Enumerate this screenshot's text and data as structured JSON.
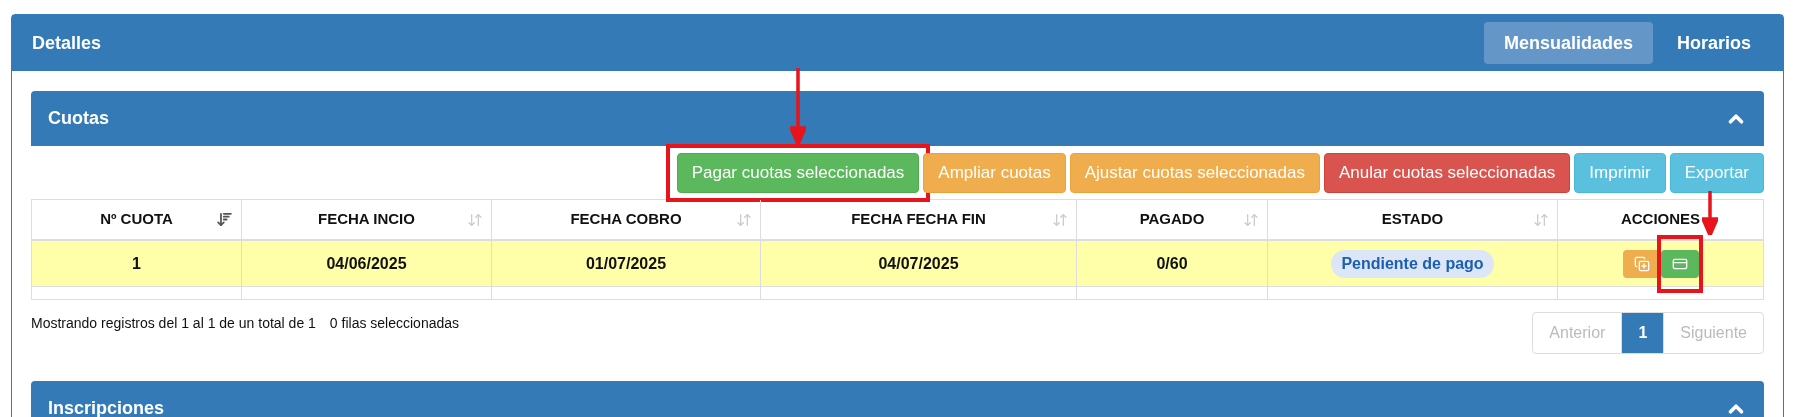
{
  "panel": {
    "title": "Detalles",
    "tabs": [
      {
        "label": "Mensualidades",
        "selected": true
      },
      {
        "label": "Horarios",
        "selected": false
      }
    ]
  },
  "cuotas": {
    "title": "Cuotas",
    "expanded": true,
    "buttons": [
      {
        "label": "Pagar cuotas seleccionadas",
        "kind": "success",
        "highlighted": true
      },
      {
        "label": "Ampliar cuotas",
        "kind": "warning",
        "highlighted": false
      },
      {
        "label": "Ajustar cuotas seleccionadas",
        "kind": "warning",
        "highlighted": false
      },
      {
        "label": "Anular cuotas seleccionadas",
        "kind": "danger",
        "highlighted": false
      },
      {
        "label": "Imprimir",
        "kind": "info",
        "highlighted": false
      },
      {
        "label": "Exportar",
        "kind": "info",
        "highlighted": false
      }
    ],
    "table": {
      "columns": [
        {
          "label": "Nº CUOTA",
          "sortable": true,
          "sorted": true
        },
        {
          "label": "FECHA INCIO",
          "sortable": true,
          "sorted": false
        },
        {
          "label": "FECHA COBRO",
          "sortable": true,
          "sorted": false
        },
        {
          "label": "FECHA FECHA FIN",
          "sortable": true,
          "sorted": false
        },
        {
          "label": "PAGADO",
          "sortable": true,
          "sorted": false
        },
        {
          "label": "ESTADO",
          "sortable": true,
          "sorted": false
        },
        {
          "label": "ACCIONES"
        }
      ],
      "rows": [
        {
          "cells": [
            "1",
            "04/06/2025",
            "01/07/2025",
            "04/07/2025",
            "0/60"
          ],
          "status": "Pendiente de pago",
          "actions": [
            {
              "kind": "copy",
              "highlighted": false
            },
            {
              "kind": "pay",
              "highlighted": true
            }
          ]
        }
      ]
    },
    "info": "Mostrando registros del 1 al 1 de un total de 1",
    "selected_info": "0 filas seleccionadas",
    "pagination": [
      {
        "label": "Anterior",
        "selected": false,
        "disabled": true
      },
      {
        "label": "1",
        "selected": true,
        "disabled": false
      },
      {
        "label": "Siguiente",
        "selected": false,
        "disabled": true
      }
    ]
  },
  "inscripciones": {
    "title": "Inscripciones",
    "expanded": true
  }
}
